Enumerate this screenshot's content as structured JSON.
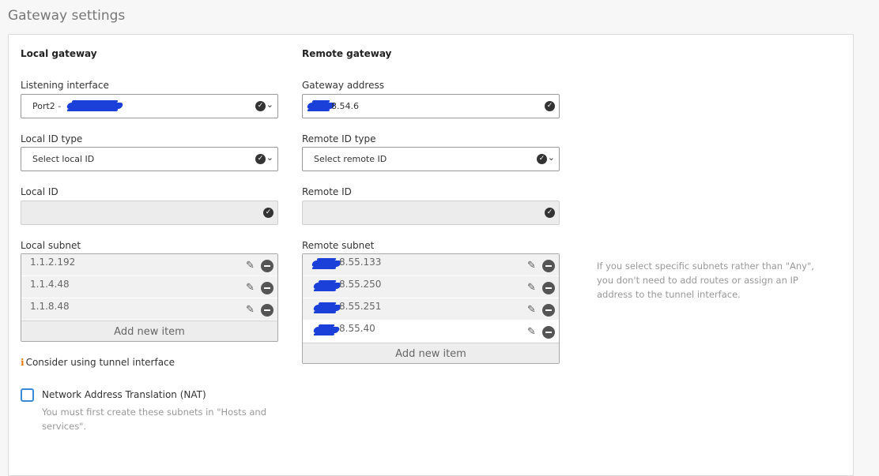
{
  "page": {
    "title": "Gateway settings"
  },
  "local": {
    "section_title": "Local gateway",
    "listening_interface": {
      "label": "Listening interface",
      "value": "Port2 -"
    },
    "local_id_type": {
      "label": "Local ID type",
      "value": "Select local ID"
    },
    "local_id": {
      "label": "Local ID",
      "value": ""
    },
    "local_subnet": {
      "label": "Local subnet",
      "items": [
        "1.1.2.192",
        "1.1.4.48",
        "1.1.8.48"
      ],
      "add_label": "Add new item"
    }
  },
  "remote": {
    "section_title": "Remote gateway",
    "gateway_address": {
      "label": "Gateway address",
      "value": "8.54.6"
    },
    "remote_id_type": {
      "label": "Remote ID type",
      "value": "Select remote ID"
    },
    "remote_id": {
      "label": "Remote ID",
      "value": ""
    },
    "remote_subnet": {
      "label": "Remote subnet",
      "items": [
        "8.55.133",
        "8.55.250",
        "8.55.251",
        "8.55.40"
      ],
      "add_label": "Add new item"
    },
    "help_text": "If you select specific subnets rather than \"Any\", you don't need to add routes or assign an IP address to the tunnel interface."
  },
  "tunnel_hint": "Consider using tunnel interface",
  "nat": {
    "label": "Network Address Translation (NAT)",
    "checked": false,
    "help_text": "You must first create these subnets in \"Hosts and services\"."
  },
  "icons": {
    "info": "info-icon",
    "valid": "check-circle-icon",
    "dropdown": "chevron-down-icon",
    "edit": "pencil-icon",
    "remove": "minus-circle-icon"
  },
  "colors": {
    "accent": "#3a8ad6",
    "info": "#e07b00",
    "redaction": "#1b3fd9"
  }
}
